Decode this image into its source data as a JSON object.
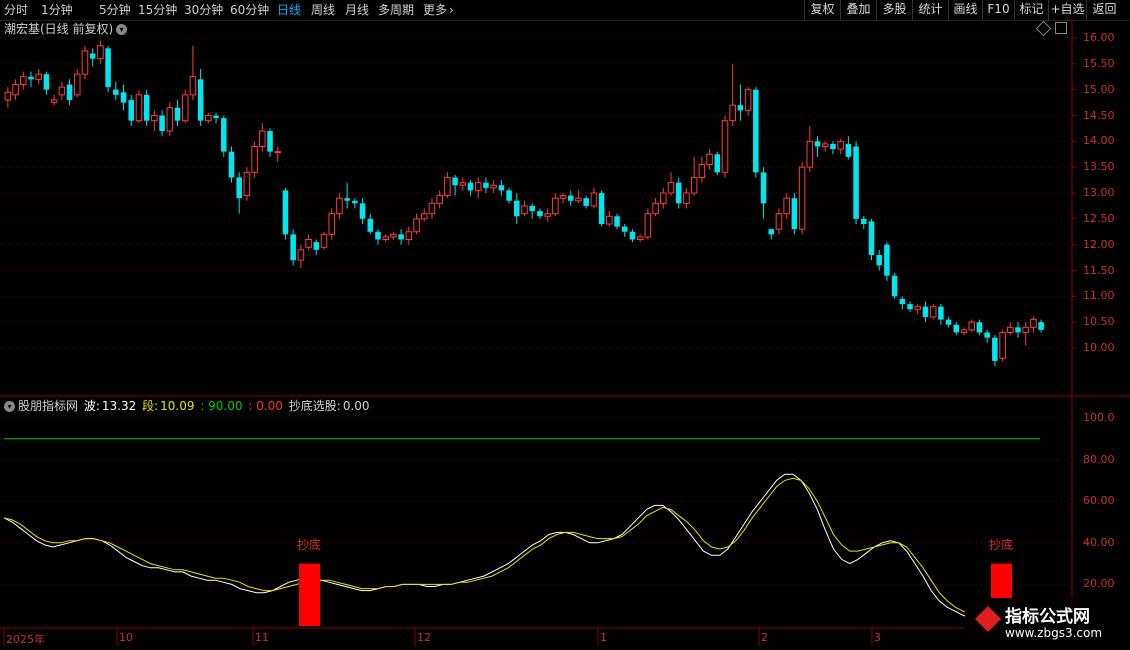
{
  "toolbar": {
    "periods": [
      "分时",
      "1分钟",
      "5分钟",
      "15分钟",
      "30分钟",
      "60分钟",
      "日线",
      "周线",
      "月线",
      "多周期",
      "更多"
    ],
    "active_period": "日线",
    "right_buttons": [
      "复权",
      "叠加",
      "多股",
      "统计",
      "画线",
      "F10",
      "标记",
      "+自选",
      "返回"
    ]
  },
  "stock": {
    "title": "潮宏基(日线 前复权)"
  },
  "indicator": {
    "name": "股朋指标网",
    "wave_label": "波:",
    "wave_value": "13.32",
    "seg_label": "段:",
    "seg_value": "10.09",
    "v90": ": 90.00",
    "v0": ": 0.00",
    "pick_label": "抄底选股:",
    "pick_value": "0.00",
    "signal_text": "抄底"
  },
  "price_axis": [
    "16.00",
    "15.50",
    "15.00",
    "14.50",
    "14.00",
    "13.50",
    "13.00",
    "12.50",
    "12.00",
    "11.50",
    "11.00",
    "10.50",
    "10.00"
  ],
  "ind_axis": [
    "100.0",
    "80.00",
    "60.00",
    "40.00",
    "20.00"
  ],
  "time_axis": [
    "2025年",
    "10",
    "11",
    "12",
    "1",
    "2",
    "3"
  ],
  "watermark": {
    "main": "指标公式网",
    "url": "www.zbgs3.com"
  },
  "colors": {
    "up": "#ff3c3c",
    "down": "#00e5ee",
    "wave": "#ffffff",
    "seg": "#e6e600",
    "level90": "#00c800",
    "signal": "#ff0000"
  },
  "chart_data": [
    {
      "type": "candlestick",
      "title": "潮宏基(日线 前复权)",
      "ylim": [
        9.4,
        16.3
      ],
      "x": [
        "2025-09",
        "2025-10",
        "2025-11",
        "2025-12",
        "2026-01",
        "2026-02",
        "2026-03"
      ],
      "candles": [
        [
          14.8,
          14.95,
          15.05,
          14.65
        ],
        [
          14.9,
          15.1,
          15.2,
          14.8
        ],
        [
          15.1,
          15.25,
          15.35,
          15.0
        ],
        [
          15.25,
          15.2,
          15.35,
          15.05
        ],
        [
          15.2,
          15.3,
          15.4,
          15.1
        ],
        [
          15.3,
          15.0,
          15.35,
          14.9
        ],
        [
          14.75,
          14.8,
          14.9,
          14.7
        ],
        [
          14.9,
          15.05,
          15.15,
          14.8
        ],
        [
          15.1,
          14.8,
          15.2,
          14.7
        ],
        [
          14.9,
          15.3,
          15.4,
          14.85
        ],
        [
          15.3,
          15.75,
          15.85,
          15.2
        ],
        [
          15.7,
          15.6,
          15.8,
          15.45
        ],
        [
          15.6,
          15.85,
          15.95,
          15.5
        ],
        [
          15.8,
          15.05,
          15.85,
          14.95
        ],
        [
          15.0,
          14.9,
          15.15,
          14.8
        ],
        [
          14.95,
          14.75,
          15.1,
          14.6
        ],
        [
          14.8,
          14.4,
          14.9,
          14.3
        ],
        [
          14.4,
          14.9,
          15.0,
          14.35
        ],
        [
          14.9,
          14.4,
          15.0,
          14.3
        ],
        [
          14.4,
          14.5,
          14.6,
          14.2
        ],
        [
          14.5,
          14.2,
          14.6,
          14.1
        ],
        [
          14.2,
          14.65,
          14.75,
          14.1
        ],
        [
          14.65,
          14.4,
          14.8,
          14.3
        ],
        [
          14.4,
          14.9,
          15.0,
          14.35
        ],
        [
          14.9,
          15.25,
          15.85,
          14.8
        ],
        [
          15.2,
          14.4,
          15.4,
          14.3
        ],
        [
          14.4,
          14.5,
          14.55,
          14.35
        ],
        [
          14.5,
          14.45,
          14.55,
          14.35
        ],
        [
          14.45,
          13.8,
          14.5,
          13.7
        ],
        [
          13.8,
          13.3,
          13.9,
          13.2
        ],
        [
          13.3,
          12.9,
          13.4,
          12.6
        ],
        [
          12.95,
          13.4,
          13.5,
          12.85
        ],
        [
          13.4,
          13.9,
          14.0,
          13.3
        ],
        [
          13.9,
          14.2,
          14.35,
          13.8
        ],
        [
          14.2,
          13.8,
          14.25,
          13.7
        ],
        [
          13.8,
          13.8,
          13.9,
          13.6
        ],
        [
          13.05,
          12.2,
          13.1,
          12.1
        ],
        [
          12.2,
          11.7,
          12.3,
          11.6
        ],
        [
          11.7,
          11.9,
          12.0,
          11.55
        ],
        [
          11.95,
          12.1,
          12.2,
          11.9
        ],
        [
          12.05,
          11.9,
          12.1,
          11.8
        ],
        [
          11.95,
          12.2,
          12.25,
          11.9
        ],
        [
          12.2,
          12.6,
          12.7,
          12.1
        ],
        [
          12.6,
          12.9,
          13.0,
          12.5
        ],
        [
          12.9,
          12.85,
          13.2,
          12.7
        ],
        [
          12.85,
          12.8,
          12.9,
          12.7
        ],
        [
          12.8,
          12.5,
          12.9,
          12.4
        ],
        [
          12.5,
          12.25,
          12.6,
          12.2
        ],
        [
          12.25,
          12.1,
          12.3,
          12.0
        ],
        [
          12.1,
          12.15,
          12.2,
          12.05
        ],
        [
          12.15,
          12.2,
          12.25,
          12.1
        ],
        [
          12.2,
          12.1,
          12.3,
          12.0
        ],
        [
          12.1,
          12.25,
          12.35,
          12.0
        ],
        [
          12.25,
          12.5,
          12.6,
          12.2
        ],
        [
          12.5,
          12.6,
          12.7,
          12.45
        ],
        [
          12.6,
          12.8,
          12.9,
          12.5
        ],
        [
          12.8,
          12.95,
          13.05,
          12.7
        ],
        [
          12.95,
          13.3,
          13.4,
          12.9
        ],
        [
          13.3,
          13.15,
          13.35,
          12.95
        ],
        [
          13.15,
          13.2,
          13.3,
          13.05
        ],
        [
          13.2,
          13.05,
          13.25,
          12.95
        ],
        [
          13.05,
          13.2,
          13.3,
          12.9
        ],
        [
          13.2,
          13.1,
          13.3,
          13.0
        ],
        [
          13.1,
          13.15,
          13.25,
          13.0
        ],
        [
          13.15,
          13.05,
          13.25,
          12.95
        ],
        [
          13.05,
          12.85,
          13.1,
          12.8
        ],
        [
          12.85,
          12.55,
          13.0,
          12.4
        ],
        [
          12.6,
          12.75,
          12.85,
          12.55
        ],
        [
          12.75,
          12.65,
          12.8,
          12.5
        ],
        [
          12.65,
          12.55,
          12.7,
          12.5
        ],
        [
          12.55,
          12.6,
          12.7,
          12.45
        ],
        [
          12.6,
          12.9,
          13.0,
          12.55
        ],
        [
          12.9,
          12.95,
          13.0,
          12.8
        ],
        [
          12.95,
          12.85,
          13.05,
          12.75
        ],
        [
          12.85,
          12.9,
          13.05,
          12.8
        ],
        [
          12.9,
          12.75,
          12.95,
          12.7
        ],
        [
          12.75,
          13.0,
          13.1,
          12.7
        ],
        [
          13.0,
          12.4,
          13.05,
          12.35
        ],
        [
          12.4,
          12.55,
          12.65,
          12.35
        ],
        [
          12.55,
          12.35,
          12.6,
          12.3
        ],
        [
          12.35,
          12.25,
          12.4,
          12.15
        ],
        [
          12.25,
          12.1,
          12.3,
          12.05
        ],
        [
          12.1,
          12.15,
          12.2,
          12.05
        ],
        [
          12.15,
          12.6,
          12.7,
          12.1
        ],
        [
          12.6,
          12.8,
          12.9,
          12.55
        ],
        [
          12.8,
          13.0,
          13.1,
          12.7
        ],
        [
          13.0,
          13.2,
          13.4,
          12.95
        ],
        [
          13.2,
          12.8,
          13.3,
          12.7
        ],
        [
          12.8,
          13.0,
          13.1,
          12.7
        ],
        [
          13.0,
          13.3,
          13.7,
          12.95
        ],
        [
          13.3,
          13.55,
          13.7,
          13.2
        ],
        [
          13.55,
          13.75,
          13.85,
          13.45
        ],
        [
          13.75,
          13.4,
          13.8,
          13.35
        ],
        [
          13.4,
          14.4,
          14.5,
          13.3
        ],
        [
          14.4,
          14.7,
          15.5,
          14.3
        ],
        [
          14.7,
          14.6,
          15.1,
          14.4
        ],
        [
          14.6,
          15.0,
          15.05,
          14.5
        ],
        [
          15.0,
          13.4,
          15.05,
          13.3
        ],
        [
          13.4,
          12.8,
          13.5,
          12.5
        ],
        [
          12.3,
          12.2,
          12.3,
          12.1
        ],
        [
          12.3,
          12.6,
          12.7,
          12.2
        ],
        [
          12.6,
          12.9,
          13.0,
          12.5
        ],
        [
          12.9,
          12.3,
          13.0,
          12.2
        ],
        [
          12.3,
          13.5,
          13.6,
          12.2
        ],
        [
          13.5,
          14.0,
          14.3,
          13.4
        ],
        [
          14.0,
          13.9,
          14.1,
          13.7
        ],
        [
          13.9,
          13.95,
          14.0,
          13.8
        ],
        [
          13.95,
          13.85,
          14.0,
          13.75
        ],
        [
          13.85,
          14.0,
          14.05,
          13.75
        ],
        [
          13.95,
          13.7,
          14.1,
          13.65
        ],
        [
          13.9,
          12.5,
          14.0,
          12.4
        ],
        [
          12.5,
          12.4,
          12.55,
          12.3
        ],
        [
          12.45,
          11.8,
          12.5,
          11.7
        ],
        [
          11.8,
          11.6,
          11.9,
          11.5
        ],
        [
          12.0,
          11.4,
          12.05,
          11.3
        ],
        [
          11.4,
          11.0,
          11.45,
          10.95
        ],
        [
          10.95,
          10.85,
          11.0,
          10.75
        ],
        [
          10.85,
          10.75,
          10.9,
          10.7
        ],
        [
          10.75,
          10.8,
          10.85,
          10.65
        ],
        [
          10.8,
          10.6,
          10.9,
          10.5
        ],
        [
          10.6,
          10.8,
          10.85,
          10.55
        ],
        [
          10.8,
          10.55,
          10.85,
          10.45
        ],
        [
          10.55,
          10.45,
          10.6,
          10.4
        ],
        [
          10.45,
          10.3,
          10.5,
          10.25
        ],
        [
          10.3,
          10.35,
          10.4,
          10.25
        ],
        [
          10.35,
          10.5,
          10.55,
          10.3
        ],
        [
          10.5,
          10.3,
          10.55,
          10.25
        ],
        [
          10.3,
          10.2,
          10.35,
          10.1
        ],
        [
          10.2,
          9.75,
          10.25,
          9.65
        ],
        [
          9.8,
          10.3,
          10.35,
          9.75
        ],
        [
          10.3,
          10.4,
          10.5,
          10.25
        ],
        [
          10.4,
          10.3,
          10.5,
          10.2
        ],
        [
          10.3,
          10.4,
          10.5,
          10.05
        ],
        [
          10.4,
          10.55,
          10.6,
          10.3
        ],
        [
          10.5,
          10.35,
          10.55,
          10.3
        ]
      ]
    },
    {
      "type": "line",
      "title": "股朋指标网",
      "ylim": [
        0,
        110
      ],
      "series": [
        {
          "name": "波",
          "values": [
            52,
            50,
            47,
            44,
            41,
            39,
            38,
            39,
            40,
            41,
            42,
            42,
            41,
            39,
            36,
            33,
            31,
            29,
            28,
            28,
            27,
            26,
            26,
            24,
            23,
            22,
            22,
            21,
            20,
            18,
            17,
            16,
            16,
            17,
            19,
            21,
            22,
            23,
            23,
            22,
            21,
            20,
            19,
            18,
            17,
            17,
            18,
            19,
            19,
            20,
            20,
            20,
            19,
            19,
            20,
            20,
            21,
            22,
            23,
            24,
            26,
            28,
            30,
            33,
            36,
            39,
            41,
            44,
            45,
            45,
            44,
            42,
            40,
            40,
            41,
            42,
            44,
            48,
            52,
            56,
            58,
            58,
            55,
            51,
            46,
            41,
            36,
            34,
            34,
            37,
            43,
            49,
            55,
            60,
            65,
            70,
            73,
            73,
            70,
            64,
            56,
            46,
            37,
            32,
            30,
            32,
            35,
            38,
            40,
            41,
            40,
            36,
            30,
            24,
            17,
            12,
            9,
            7,
            5,
            4,
            3,
            3,
            3,
            3,
            3,
            3,
            4,
            5,
            6
          ]
        },
        {
          "name": "段",
          "values": [
            52,
            51,
            49,
            46,
            43,
            41,
            40,
            40,
            41,
            41,
            42,
            42,
            41,
            40,
            38,
            36,
            34,
            32,
            30,
            29,
            28,
            27,
            27,
            26,
            25,
            24,
            23,
            23,
            22,
            21,
            19,
            18,
            17,
            17,
            18,
            19,
            20,
            21,
            22,
            22,
            22,
            21,
            20,
            19,
            18,
            18,
            18,
            19,
            19,
            20,
            20,
            20,
            20,
            20,
            20,
            20,
            21,
            21,
            22,
            23,
            24,
            26,
            28,
            31,
            34,
            37,
            39,
            42,
            44,
            45,
            45,
            44,
            43,
            42,
            42,
            42,
            43,
            46,
            49,
            53,
            55,
            57,
            56,
            53,
            50,
            46,
            41,
            38,
            37,
            38,
            41,
            46,
            52,
            57,
            62,
            67,
            70,
            71,
            70,
            66,
            60,
            52,
            44,
            39,
            36,
            36,
            37,
            38,
            39,
            40,
            40,
            38,
            33,
            28,
            22,
            16,
            12,
            9,
            7,
            6,
            5,
            4,
            4,
            4,
            4,
            4,
            5,
            5,
            6
          ]
        },
        {
          "name": "90",
          "values": [
            90
          ]
        }
      ],
      "signals": [
        {
          "label": "抄底",
          "value": 30
        },
        {
          "label": "抄底",
          "value": 30
        }
      ]
    }
  ]
}
